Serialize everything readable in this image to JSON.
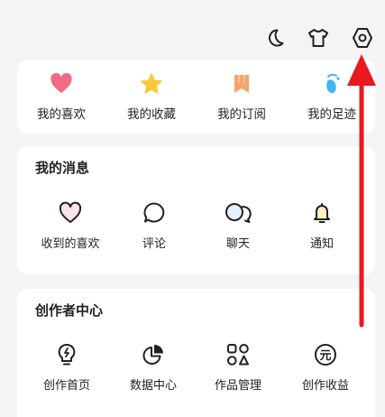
{
  "top_icons": [
    "moon-icon",
    "tshirt-icon",
    "settings-hex-icon"
  ],
  "quick_links": [
    {
      "label": "我的喜欢",
      "icon": "heart-icon",
      "color": "#f26b86"
    },
    {
      "label": "我的收藏",
      "icon": "star-icon",
      "color": "#f9c93c"
    },
    {
      "label": "我的订阅",
      "icon": "bookmark-icon",
      "color": "#f5a56a"
    },
    {
      "label": "我的足迹",
      "icon": "footprint-icon",
      "color": "#3fb6f1"
    }
  ],
  "messages": {
    "title": "我的消息",
    "items": [
      {
        "label": "收到的喜欢",
        "icon": "heart-outline-icon"
      },
      {
        "label": "评论",
        "icon": "comment-icon"
      },
      {
        "label": "聊天",
        "icon": "chat-icon"
      },
      {
        "label": "通知",
        "icon": "bell-icon"
      }
    ]
  },
  "creator": {
    "title": "创作者中心",
    "items": [
      {
        "label": "创作首页",
        "icon": "bulb-icon"
      },
      {
        "label": "数据中心",
        "icon": "pie-chart-icon"
      },
      {
        "label": "作品管理",
        "icon": "grid-shapes-icon"
      },
      {
        "label": "创作收益",
        "icon": "yuan-coin-icon",
        "symbol": "元"
      }
    ]
  },
  "annotation": {
    "color": "#e8191f"
  }
}
